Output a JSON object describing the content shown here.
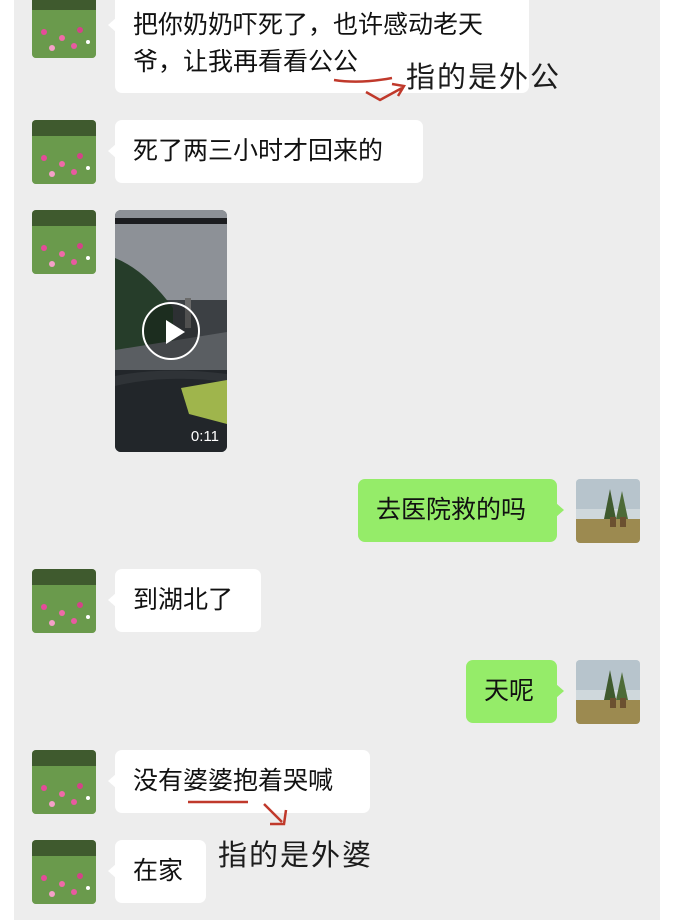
{
  "messages": [
    {
      "from": "other",
      "text_line1": "把你奶奶吓死了，也许感动老天",
      "text_line2": "爷，让我再看看公公"
    },
    {
      "from": "other",
      "text": "死了两三小时才回来的"
    },
    {
      "from": "other",
      "type": "video",
      "duration": "0:11"
    },
    {
      "from": "me",
      "text": "去医院救的吗"
    },
    {
      "from": "other",
      "text": "到湖北了"
    },
    {
      "from": "me",
      "text": "天呢"
    },
    {
      "from": "other",
      "text": "没有婆婆抱着哭喊"
    },
    {
      "from": "other",
      "text": "在家"
    }
  ],
  "annotations": [
    {
      "text": "指的是外公",
      "color": "#c0392b"
    },
    {
      "text": "指的是外婆",
      "color": "#c0392b"
    }
  ],
  "colors": {
    "background": "#ededed",
    "my_bubble": "#95ec69",
    "their_bubble": "#ffffff"
  }
}
